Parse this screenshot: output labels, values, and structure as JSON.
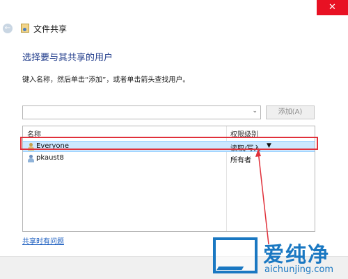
{
  "window": {
    "close_glyph": "✕",
    "back_glyph": "←",
    "title": "文件共享"
  },
  "page": {
    "heading": "选择要与其共享的用户",
    "instruction": "键入名称，然后单击“添加”，或者单击箭头查找用户。"
  },
  "input": {
    "value": "",
    "chevron": "⌄",
    "add_label": "添加(A)"
  },
  "table": {
    "headers": {
      "name": "名称",
      "permission": "权限级别"
    },
    "rows": [
      {
        "name": "Everyone",
        "permission": "读取/写入",
        "dropdown": "▼",
        "selected": true
      },
      {
        "name": "pkaust8",
        "permission": "所有者",
        "selected": false
      }
    ]
  },
  "help_link": "共享时有问题",
  "watermark": {
    "text": "爱纯净",
    "url": "aichunjing.com"
  },
  "colors": {
    "accent": "#1a78c2",
    "highlight": "#e0303a",
    "selection": "#cde8ff"
  }
}
